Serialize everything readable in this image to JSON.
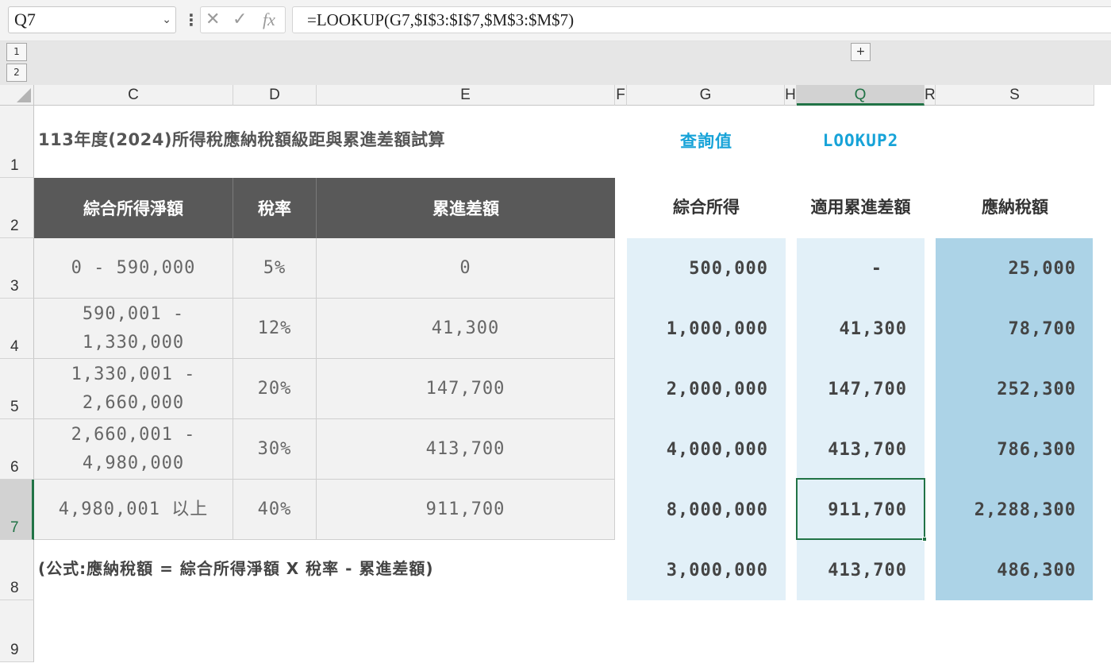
{
  "formula_bar": {
    "name_box": "Q7",
    "formula": "=LOOKUP(G7,$I$3:$I$7,$M$3:$M$7)"
  },
  "outline": {
    "levels": [
      "1",
      "2"
    ],
    "expand": "+"
  },
  "columns": [
    "C",
    "D",
    "E",
    "F",
    "G",
    "H",
    "Q",
    "R",
    "S"
  ],
  "rows": [
    "1",
    "2",
    "3",
    "4",
    "5",
    "6",
    "7",
    "8",
    "9"
  ],
  "sheet": {
    "title": "113年度(2024)所得稅應納稅額級距與累進差額試算",
    "table_headers": [
      "綜合所得淨額",
      "稅率",
      "累進差額"
    ],
    "brackets": [
      {
        "range": "0 - 590,000",
        "rate": "5%",
        "diff": "0"
      },
      {
        "range": "590,001 -\n1,330,000",
        "rate": "12%",
        "diff": "41,300"
      },
      {
        "range": "1,330,001 -\n2,660,000",
        "rate": "20%",
        "diff": "147,700"
      },
      {
        "range": "2,660,001 -\n4,980,000",
        "rate": "30%",
        "diff": "413,700"
      },
      {
        "range": "4,980,001 以上",
        "rate": "40%",
        "diff": "911,700"
      }
    ],
    "note": "(公式:應納稅額 = 綜合所得淨額 X 稅率 - 累進差額)",
    "query_label": "查詢值",
    "lookup_label": "LOOKUP2",
    "result_headers": [
      "綜合所得",
      "適用累進差額",
      "應納稅額"
    ],
    "results": [
      {
        "income": "500,000",
        "diff": "-",
        "tax": "25,000"
      },
      {
        "income": "1,000,000",
        "diff": "41,300",
        "tax": "78,700"
      },
      {
        "income": "2,000,000",
        "diff": "147,700",
        "tax": "252,300"
      },
      {
        "income": "4,000,000",
        "diff": "413,700",
        "tax": "786,300"
      },
      {
        "income": "8,000,000",
        "diff": "911,700",
        "tax": "2,288,300"
      },
      {
        "income": "3,000,000",
        "diff": "413,700",
        "tax": "486,300"
      }
    ]
  },
  "colors": {
    "accent": "#217346",
    "header_fill": "#595959",
    "light_blue": "#e2f0f8",
    "mid_blue": "#acd3e7",
    "cyan_text": "#17a3d8"
  }
}
